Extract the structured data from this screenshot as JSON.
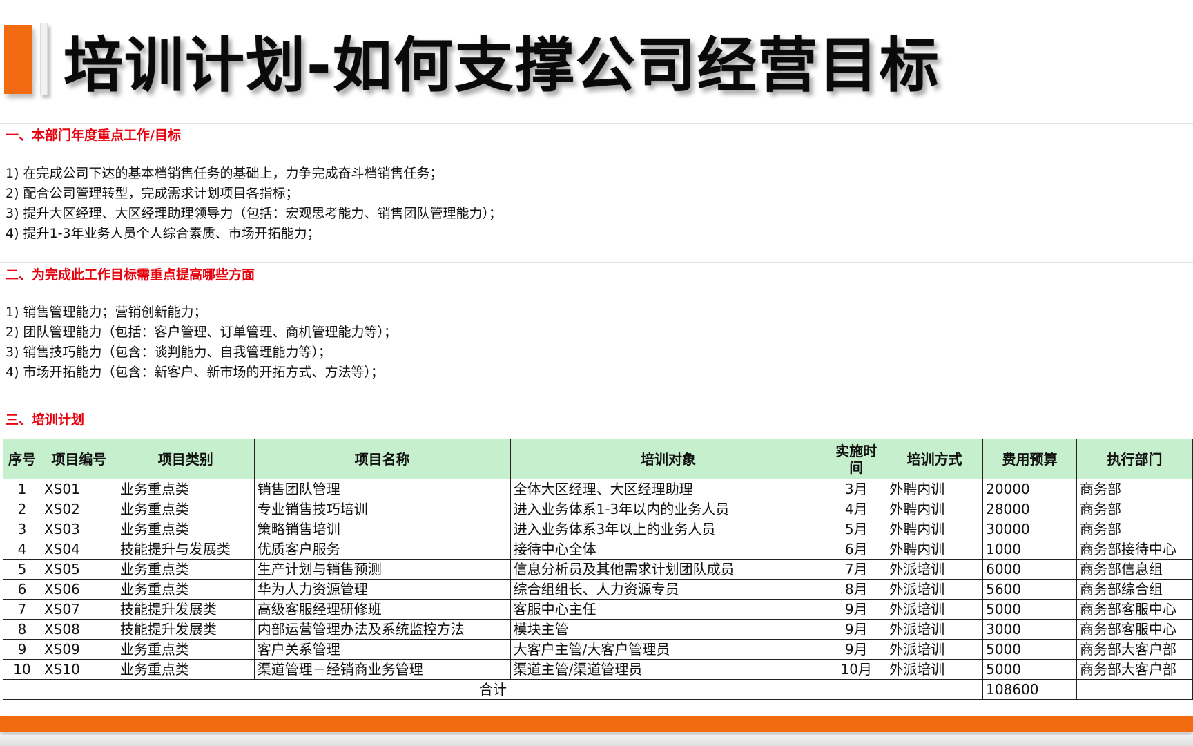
{
  "page": {
    "title": "培训计划-如何支撑公司经营目标"
  },
  "colors": {
    "accent": "#f26b10",
    "heading_red": "#e8000d",
    "table_header_bg": "#c6efce"
  },
  "section1": {
    "heading": "一、本部门年度重点工作/目标",
    "items": [
      "1) 在完成公司下达的基本档销售任务的基础上，力争完成奋斗档销售任务；",
      "2) 配合公司管理转型，完成需求计划项目各指标；",
      "3) 提升大区经理、大区经理助理领导力（包括：宏观思考能力、销售团队管理能力）；",
      "4) 提升1-3年业务人员个人综合素质、市场开拓能力；"
    ]
  },
  "section2": {
    "heading": "二、为完成此工作目标需重点提高哪些方面",
    "items": [
      "1) 销售管理能力；营销创新能力；",
      "2) 团队管理能力（包括：客户管理、订单管理、商机管理能力等）；",
      "3) 销售技巧能力（包含：谈判能力、自我管理能力等）；",
      "4) 市场开拓能力（包含：新客户、新市场的开拓方式、方法等）；"
    ]
  },
  "section3": {
    "heading": "三、培训计划"
  },
  "table": {
    "headers": [
      "序号",
      "项目编号",
      "项目类别",
      "项目名称",
      "培训对象",
      "实施时间",
      "培训方式",
      "费用预算",
      "执行部门"
    ],
    "rows": [
      [
        "1",
        "XS01",
        "业务重点类",
        "销售团队管理",
        " 全体大区经理、大区经理助理",
        "3月",
        "外聘内训",
        "20000",
        "商务部"
      ],
      [
        "2",
        "XS02",
        "业务重点类",
        "专业销售技巧培训",
        "进入业务体系1-3年以内的业务人员",
        "4月",
        "外聘内训",
        "28000",
        "商务部"
      ],
      [
        "3",
        "XS03",
        "业务重点类",
        "策略销售培训",
        "进入业务体系3年以上的业务人员",
        "5月",
        "外聘内训",
        "30000",
        "商务部"
      ],
      [
        "4",
        "XS04",
        "技能提升与发展类",
        "优质客户服务",
        "接待中心全体",
        "6月",
        "外聘内训",
        "1000",
        "商务部接待中心"
      ],
      [
        "5",
        "XS05",
        "业务重点类",
        "生产计划与销售预测",
        "信息分析员及其他需求计划团队成员",
        "7月",
        "外派培训",
        "6000",
        "商务部信息组"
      ],
      [
        "6",
        "XS06",
        "业务重点类",
        "华为人力资源管理",
        "综合组组长、人力资源专员",
        "8月",
        "外派培训",
        "5600",
        "商务部综合组"
      ],
      [
        "7",
        "XS07",
        "技能提升发展类",
        "高级客服经理研修班",
        "客服中心主任",
        "9月",
        "外派培训",
        "5000",
        "商务部客服中心"
      ],
      [
        "8",
        "XS08",
        "技能提升发展类",
        "内部运营管理办法及系统监控方法",
        "模块主管",
        "9月",
        "外派培训",
        "3000",
        "商务部客服中心"
      ],
      [
        "9",
        "XS09",
        "业务重点类",
        "客户关系管理",
        "大客户主管/大客户管理员",
        "9月",
        "外派培训",
        "5000",
        "商务部大客户部"
      ],
      [
        "10",
        "XS10",
        "业务重点类",
        "渠道管理－经销商业务管理",
        "渠道主管/渠道管理员",
        "10月",
        "外派培训",
        "5000",
        "商务部大客户部"
      ]
    ],
    "total_label": "合计",
    "total_value": "108600"
  }
}
